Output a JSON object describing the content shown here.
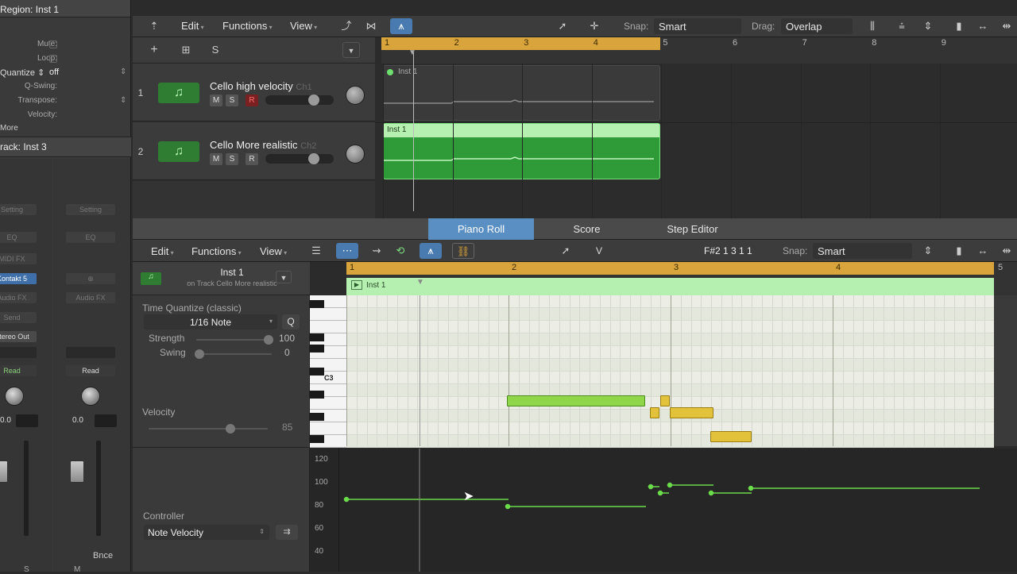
{
  "inspector": {
    "region_title": "Region: Inst 1",
    "mute_label": "Mute:",
    "loop_label": "Loop:",
    "quantize_label": "Quantize ⇕",
    "quantize_value": "off",
    "qswing_label": "Q-Swing:",
    "transpose_label": "Transpose:",
    "velocity_label": "Velocity:",
    "more_label": "More",
    "track_title": "rack:  Inst 3",
    "strip1": {
      "setting": "Setting",
      "eq": "EQ",
      "midifx": "MIDI FX",
      "instrument": "Kontakt 5",
      "audiofx": "Audio FX",
      "send": "Send",
      "output": "Stereo Out",
      "automation": "Read",
      "vol": "0.0",
      "bottom": "S"
    },
    "strip2": {
      "setting": "Setting",
      "eq": "EQ",
      "link": "⊕",
      "audiofx": "Audio FX",
      "automation": "Read",
      "vol": "0.0",
      "bounce": "Bnce",
      "bottom": "M"
    }
  },
  "main_toolbar": {
    "edit": "Edit",
    "functions": "Functions",
    "view": "View",
    "snap_label": "Snap:",
    "snap_value": "Smart",
    "drag_label": "Drag:",
    "drag_value": "Overlap"
  },
  "track_toolbar": {
    "add": "+",
    "folder": "⊞",
    "s": "S"
  },
  "top_ruler": {
    "bars": [
      "1",
      "2",
      "3",
      "4",
      "5",
      "6",
      "7",
      "8",
      "9"
    ]
  },
  "tracks": [
    {
      "num": "1",
      "name": "Cello high velocity",
      "channel": "Ch1",
      "m": "M",
      "s": "S",
      "r": "R",
      "region": "Inst 1"
    },
    {
      "num": "2",
      "name": "Cello More realistic",
      "channel": "Ch2",
      "m": "M",
      "s": "S",
      "r": "R",
      "region": "Inst 1"
    }
  ],
  "editor_tabs": [
    "Piano Roll",
    "Score",
    "Step Editor"
  ],
  "pr_toolbar": {
    "edit": "Edit",
    "functions": "Functions",
    "view": "View",
    "pointer": "V",
    "position": "F#2  1 3 1 1",
    "snap_label": "Snap:",
    "snap_value": "Smart"
  },
  "pr_ruler": {
    "bars": [
      "1",
      "2",
      "3",
      "4",
      "5"
    ]
  },
  "pr_region": {
    "name": "Inst 1",
    "subtitle": "on Track Cello More realistic"
  },
  "pr_left": {
    "tq_label": "Time Quantize (classic)",
    "tq_value": "1/16 Note",
    "q_button": "Q",
    "strength_label": "Strength",
    "strength_value": "100",
    "swing_label": "Swing",
    "swing_value": "0",
    "velocity_label": "Velocity",
    "velocity_value": "85",
    "controller_label": "Controller",
    "controller_value": "Note Velocity"
  },
  "keyboard": {
    "c3_label": "C3"
  },
  "ctrl_axis": [
    "120",
    "100",
    "80",
    "60",
    "40"
  ],
  "colors": {
    "accent": "#4a7bb0",
    "region_green": "#2f9a38",
    "cycle": "#d9a43b",
    "note_green": "#8fd64a",
    "note_yellow": "#e2c23b"
  }
}
